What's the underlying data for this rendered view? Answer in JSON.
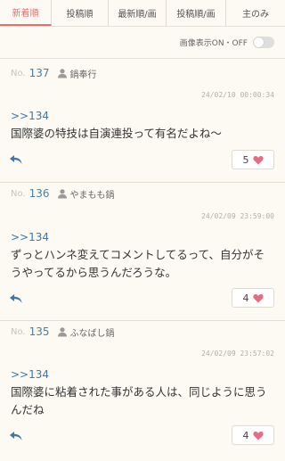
{
  "tabs": [
    {
      "label": "新着順",
      "active": true
    },
    {
      "label": "投稿順",
      "active": false
    },
    {
      "label": "最新順/画",
      "active": false
    },
    {
      "label": "投稿順/画",
      "active": false
    },
    {
      "label": "主のみ",
      "active": false
    }
  ],
  "image_toggle": {
    "label": "画像表示ON・OFF",
    "on": false
  },
  "no_label": "No.",
  "colors": {
    "accent": "#e0726e",
    "link": "#3c78a8",
    "heart": "#e86a83"
  },
  "posts": [
    {
      "number": "137",
      "user": "鍋奉行",
      "timestamp": "24/02/10 00:00:34",
      "anchor": ">>134",
      "body": "国際婆の特技は自演連投って有名だよね〜",
      "likes": "5"
    },
    {
      "number": "136",
      "user": "やまもも鍋",
      "timestamp": "24/02/09 23:59:00",
      "anchor": ">>134",
      "body": "ずっとハンネ変えてコメントしてるって、自分がそうやってるから思うんだろうな。",
      "likes": "4"
    },
    {
      "number": "135",
      "user": "ふなばし鍋",
      "timestamp": "24/02/09 23:57:02",
      "anchor": ">>134",
      "body": "国際婆に粘着された事がある人は、同じように思うんだね",
      "likes": "4"
    }
  ]
}
